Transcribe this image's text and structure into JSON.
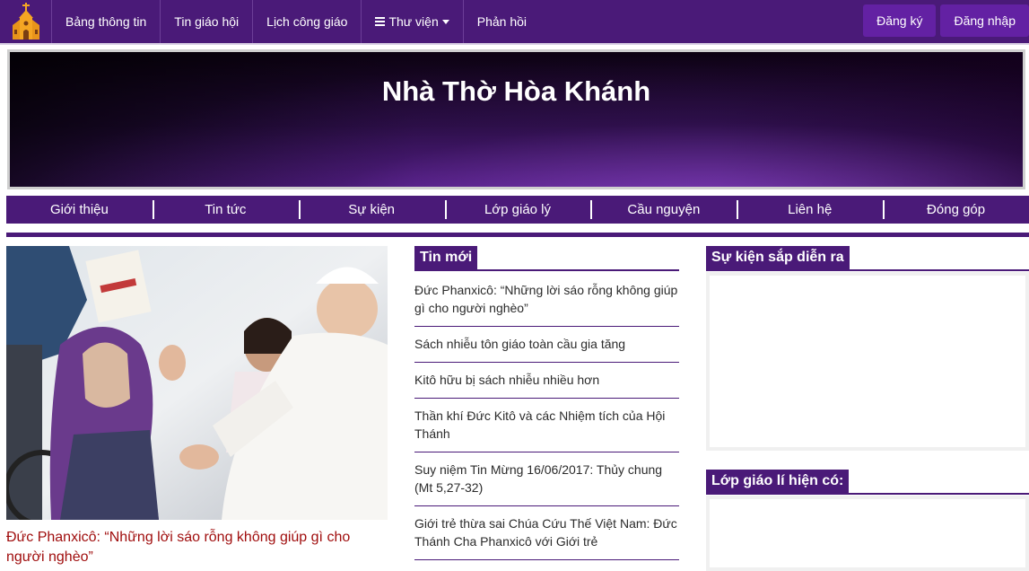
{
  "topnav": {
    "items": [
      "Bảng thông tin",
      "Tin giáo hội",
      "Lịch công giáo",
      "Thư viện",
      "Phản hồi"
    ],
    "register": "Đăng ký",
    "login": "Đăng nhập"
  },
  "banner": {
    "title": "Nhà Thờ Hòa Khánh"
  },
  "subnav": {
    "items": [
      "Giới thiệu",
      "Tin tức",
      "Sự kiện",
      "Lớp giáo lý",
      "Cầu nguyện",
      "Liên hệ",
      "Đóng góp"
    ]
  },
  "featured": {
    "title": "Đức Phanxicô: “Những lời sáo rỗng không giúp gì cho người nghèo”"
  },
  "news": {
    "heading": "Tin mới",
    "items": [
      "Đức Phanxicô: “Những lời sáo rỗng không giúp gì cho người nghèo”",
      "Sách nhiễu tôn giáo toàn cầu gia tăng",
      "Kitô hữu bị sách nhiễu nhiều hơn",
      "Thần khí Đức Kitô và các Nhiệm tích của Hội Thánh",
      "Suy niệm Tin Mừng 16/06/2017: Thủy chung (Mt 5,27-32)",
      "Giới trẻ thừa sai Chúa Cứu Thế Việt Nam: Đức Thánh Cha Phanxicô với Giới trẻ"
    ]
  },
  "sidebar": {
    "events_heading": "Sự kiện sắp diễn ra",
    "classes_heading": "Lớp giáo lí hiện có:"
  },
  "colors": {
    "primary": "#4a1a78",
    "accent": "#6321a3",
    "featured_title": "#a00e0e"
  }
}
